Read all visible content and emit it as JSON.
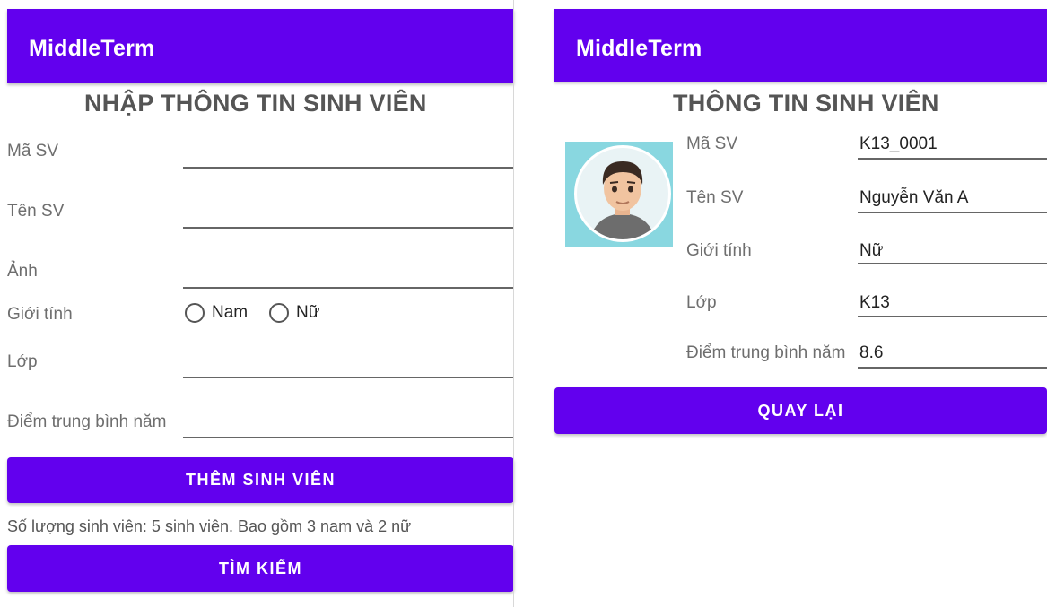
{
  "left_screen": {
    "app_title": "MiddleTerm",
    "heading": "NHẬP THÔNG TIN SINH VIÊN",
    "fields": {
      "ma_sv": {
        "label": "Mã SV",
        "value": ""
      },
      "ten_sv": {
        "label": "Tên SV",
        "value": ""
      },
      "anh": {
        "label": "Ảnh",
        "value": ""
      },
      "gioi_tinh": {
        "label": "Giới tính",
        "options": [
          "Nam",
          "Nữ"
        ]
      },
      "lop": {
        "label": "Lớp",
        "value": ""
      },
      "diem_tb": {
        "label": "Điểm trung bình năm",
        "value": ""
      }
    },
    "add_button": "THÊM SINH VIÊN",
    "summary": "Số lượng sinh viên: 5 sinh viên. Bao gồm 3 nam và 2 nữ",
    "search_button": "TÌM KIẾM"
  },
  "right_screen": {
    "app_title": "MiddleTerm",
    "heading": "THÔNG TIN SINH VIÊN",
    "avatar_icon": "student-avatar",
    "rows": [
      {
        "label": "Mã SV",
        "value": "K13_0001"
      },
      {
        "label": "Tên SV",
        "value": "Nguyễn Văn A"
      },
      {
        "label": "Giới tính",
        "value": "Nữ"
      },
      {
        "label": "Lớp",
        "value": "K13"
      },
      {
        "label": "Điểm trung bình năm",
        "value": "8.6"
      }
    ],
    "back_button": "QUAY LẠI"
  },
  "colors": {
    "primary": "#6200ee",
    "appbar_text": "#ffffff"
  }
}
